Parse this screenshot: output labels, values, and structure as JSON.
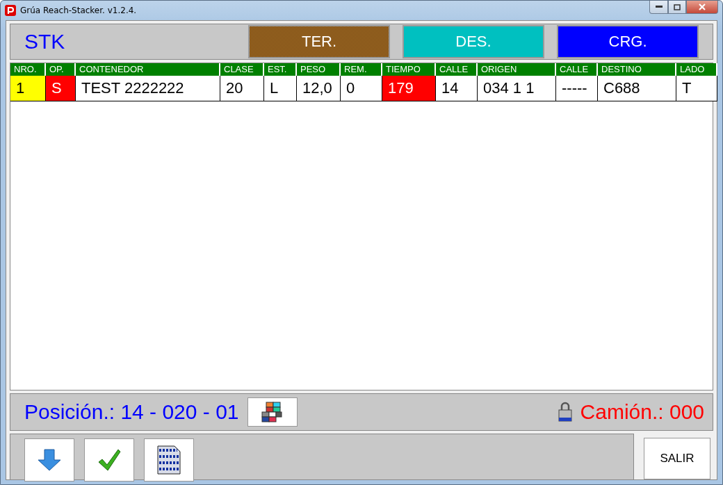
{
  "window": {
    "title": "Grúa Reach-Stacker. v1.2.4."
  },
  "header": {
    "label": "STK",
    "modes": [
      {
        "label": "TER.",
        "selected": true,
        "color": "#b07a2a"
      },
      {
        "label": "DES.",
        "selected": false,
        "color": "#00c0c0"
      },
      {
        "label": "CRG.",
        "selected": false,
        "color": "#0000ff"
      }
    ]
  },
  "table": {
    "columns": [
      "NRO.",
      "OP.",
      "CONTENEDOR",
      "CLASE",
      "EST.",
      "PESO",
      "REM.",
      "TIEMPO",
      "CALLE",
      "ORIGEN",
      "CALLE",
      "DESTINO",
      "LADO"
    ],
    "rows": [
      {
        "selected": false,
        "cells": [
          {
            "text": "1",
            "color": "#ffff00"
          },
          {
            "text": "S",
            "color": "#ff0000"
          },
          {
            "text": "TEST 2222222"
          },
          {
            "text": "20"
          },
          {
            "text": "L"
          },
          {
            "text": "12,0"
          },
          {
            "text": "0"
          },
          {
            "text": "179",
            "color": "#ff0000"
          },
          {
            "text": "14"
          },
          {
            "text": "034 1 1"
          },
          {
            "text": "-----"
          },
          {
            "text": "C688"
          },
          {
            "text": "T"
          }
        ]
      }
    ]
  },
  "position": {
    "label": "Posición.: 14 - 020 - 01",
    "truck": "Camión.: 000"
  },
  "toolbar": {
    "exit": "SALIR"
  }
}
